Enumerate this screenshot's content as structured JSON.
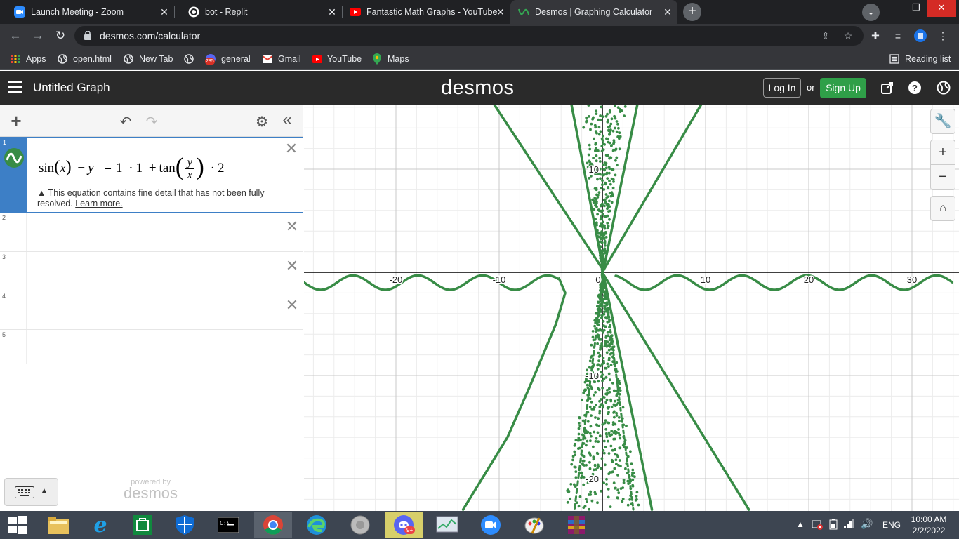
{
  "browser": {
    "tabs": [
      {
        "title": "Launch Meeting - Zoom",
        "icon": "zoom-icon",
        "active": false
      },
      {
        "title": "bot - Replit",
        "icon": "replit-icon",
        "active": false
      },
      {
        "title": "Fantastic Math Graphs - YouTube",
        "icon": "youtube-icon",
        "active": false
      },
      {
        "title": "Desmos | Graphing Calculator",
        "icon": "desmos-icon",
        "active": true
      }
    ],
    "url": "desmos.com/calculator",
    "bookmarks": [
      {
        "label": "Apps",
        "icon": "apps-grid-icon"
      },
      {
        "label": "open.html",
        "icon": "globe-icon"
      },
      {
        "label": "New Tab",
        "icon": "globe-icon"
      },
      {
        "label": "",
        "icon": "globe-icon"
      },
      {
        "label": "general",
        "icon": "discord-icon",
        "badge": "285"
      },
      {
        "label": "Gmail",
        "icon": "gmail-icon"
      },
      {
        "label": "YouTube",
        "icon": "youtube-icon"
      },
      {
        "label": "Maps",
        "icon": "maps-icon"
      }
    ],
    "reading_list": "Reading list"
  },
  "desmos": {
    "graph_title": "Untitled Graph",
    "logo": "desmos",
    "login": "Log In",
    "or": "or",
    "signup": "Sign Up",
    "accent": "#2f9f48",
    "expressions": [
      {
        "index": "1",
        "latex_parts": {
          "sin": "sin",
          "x": "x",
          "minus": "−",
          "y": "y",
          "eq": "=",
          "one_a": "1",
          "dot": "·",
          "one_b": "1",
          "plus": "+",
          "tan": "tan",
          "frac_num": "y",
          "frac_den": "x",
          "two": "2"
        },
        "warning": "This equation contains fine detail that has not been fully resolved.",
        "learn_more": "Learn more.",
        "color": "#388c46"
      },
      {
        "index": "2"
      },
      {
        "index": "3"
      },
      {
        "index": "4"
      },
      {
        "index": "5"
      }
    ],
    "powered_by": "powered by",
    "powered_logo": "desmos"
  },
  "graph": {
    "x_ticks": [
      "-20",
      "-10",
      "0",
      "10",
      "20",
      "30"
    ],
    "y_ticks": [
      "10",
      "-10",
      "-20"
    ],
    "curve_color": "#388c46",
    "grid": true
  },
  "taskbar": {
    "language": "ENG",
    "time": "10:00 AM",
    "date": "2/2/2022",
    "discord_badge": "9+"
  }
}
